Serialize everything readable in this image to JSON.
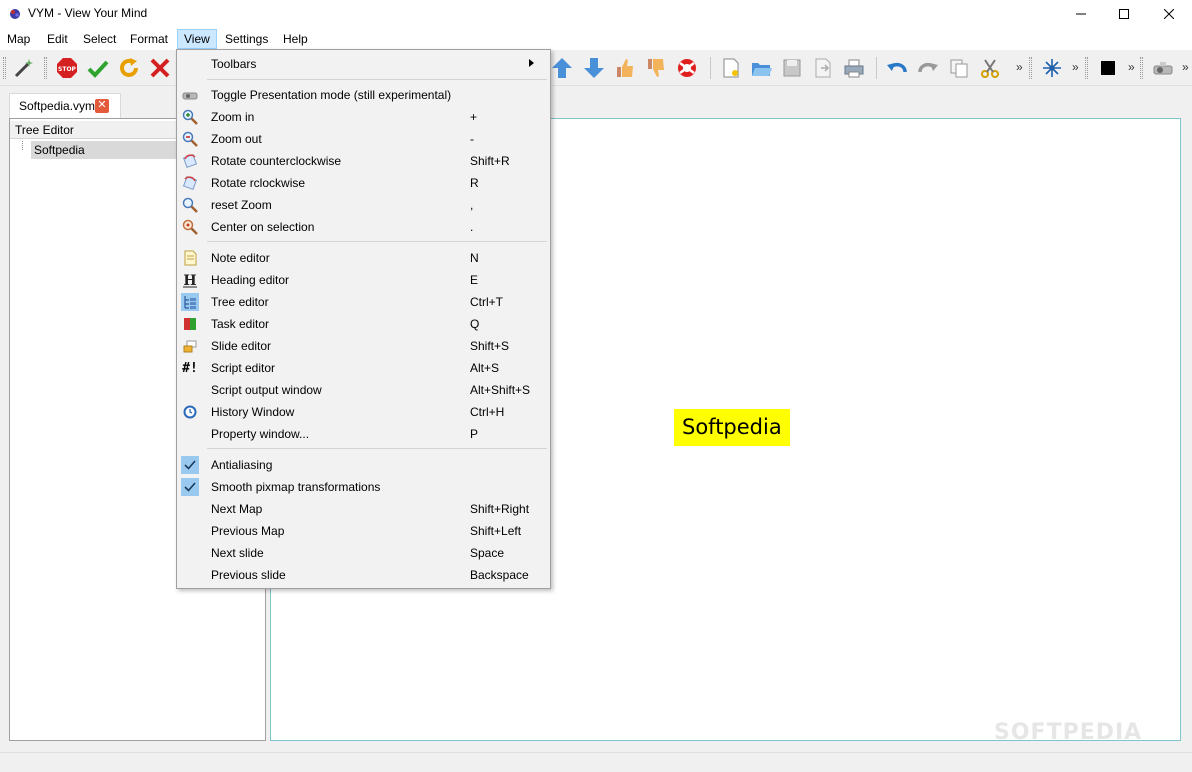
{
  "window": {
    "title": "VYM - View Your Mind"
  },
  "menubar": {
    "items": [
      "Map",
      "Edit",
      "Select",
      "Format",
      "View",
      "Settings",
      "Help"
    ],
    "active": "View"
  },
  "toolbar": {
    "overflow": "»"
  },
  "tabs": [
    {
      "label": "Softpedia.vym"
    }
  ],
  "tree_editor": {
    "title": "Tree Editor",
    "root": "Softpedia"
  },
  "map": {
    "node": "Softpedia",
    "node_color": "#ffff00"
  },
  "watermark": "SOFTPEDIA",
  "view_menu": {
    "toolbars": "Toolbars",
    "items": [
      {
        "label": "Toggle Presentation mode (still experimental)",
        "shortcut": ""
      },
      {
        "label": "Zoom in",
        "shortcut": "+"
      },
      {
        "label": "Zoom out",
        "shortcut": "-"
      },
      {
        "label": "Rotate counterclockwise",
        "shortcut": "Shift+R"
      },
      {
        "label": "Rotate rclockwise",
        "shortcut": "R"
      },
      {
        "label": "reset Zoom",
        "shortcut": ","
      },
      {
        "label": "Center on selection",
        "shortcut": "."
      },
      {
        "label": "Note editor",
        "shortcut": "N"
      },
      {
        "label": "Heading editor",
        "shortcut": "E"
      },
      {
        "label": "Tree editor",
        "shortcut": "Ctrl+T"
      },
      {
        "label": "Task editor",
        "shortcut": "Q"
      },
      {
        "label": "Slide editor",
        "shortcut": "Shift+S"
      },
      {
        "label": "Script editor",
        "shortcut": "Alt+S"
      },
      {
        "label": "Script output window",
        "shortcut": "Alt+Shift+S"
      },
      {
        "label": "History Window",
        "shortcut": "Ctrl+H"
      },
      {
        "label": "Property window...",
        "shortcut": "P"
      },
      {
        "label": "Antialiasing",
        "shortcut": ""
      },
      {
        "label": "Smooth pixmap transformations",
        "shortcut": ""
      },
      {
        "label": "Next Map",
        "shortcut": "Shift+Right"
      },
      {
        "label": "Previous Map",
        "shortcut": "Shift+Left"
      },
      {
        "label": "Next slide",
        "shortcut": "Space"
      },
      {
        "label": "Previous slide",
        "shortcut": "Backspace"
      }
    ],
    "script_icon": "#!"
  }
}
